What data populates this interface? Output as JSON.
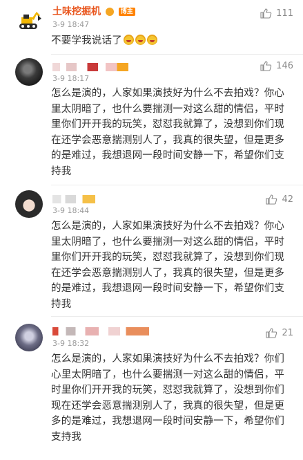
{
  "top": {
    "author": "土味挖掘机",
    "badge": "博主",
    "time": "3-9 18:47",
    "likes": "111",
    "text": "不要学我说话了",
    "emoji_icons": [
      "emoji-icon",
      "emoji-icon",
      "emoji-icon"
    ]
  },
  "comments": [
    {
      "time": "3-9 18:17",
      "likes": "146",
      "text": "怎么是演的，人家如果演技好为什么不去拍戏？你心里太阴暗了，也什么要揣测一对这么甜的情侣，平时里你们开开我的玩笑，怼怼我就算了，没想到你们现在还学会恶意揣测别人了，我真的很失望，但是更多的是难过，我想退网一段时间安静一下，希望你们支持我"
    },
    {
      "time": "3-9 18:44",
      "likes": "42",
      "text": "怎么是演的，人家如果演技好为什么不去拍戏？你心里太阴暗了，也什么要揣测一对这么甜的情侣，平时里你们开开我的玩笑，怼怼我就算了，没想到你们现在还学会恶意揣测别人了，我真的很失望，但是更多的是难过，我想退网一段时间安静一下，希望你们支持我"
    },
    {
      "time": "3-9 18:32",
      "likes": "21",
      "text": "怎么是演的，人家如果演技好为什么不去拍戏？你们心里太阴暗了，也什么要揣测一对这么甜的情侣，平时里你们开开我的玩笑，怼怼我就算了，没想到你们现在还学会恶意揣测别人了，我真的很失望，但是更多的是难过，我想退网一段时间安静一下，希望你们支持我"
    }
  ],
  "colors": {
    "author_name": "#e9571f",
    "badge_bg": "#ff8200",
    "meta_text": "#9a9a9a",
    "body_text": "#333333"
  }
}
